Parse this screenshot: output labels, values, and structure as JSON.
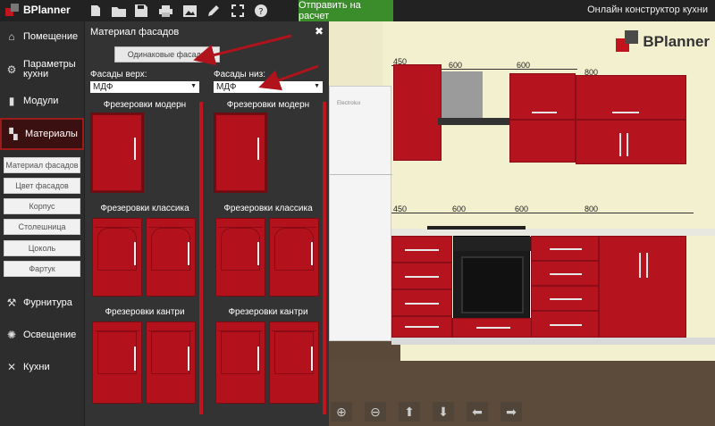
{
  "app": {
    "logo_text": "BPlanner",
    "send_button": "Отправить на расчет",
    "top_right_text": "Онлайн конструктор кухни"
  },
  "toolbar_icons": [
    "new-file-icon",
    "open-folder-icon",
    "save-icon",
    "print-icon",
    "image-icon",
    "pencil-icon",
    "fullscreen-icon",
    "help-icon"
  ],
  "sidebar": {
    "items": [
      {
        "label": "Помещение",
        "icon": "home-icon"
      },
      {
        "label": "Параметры кухни",
        "icon": "gear-icon"
      },
      {
        "label": "Модули",
        "icon": "module-icon"
      },
      {
        "label": "Материалы",
        "icon": "paint-roller-icon"
      },
      {
        "label": "Фурнитура",
        "icon": "hammer-icon"
      },
      {
        "label": "Освещение",
        "icon": "lightbulb-icon"
      },
      {
        "label": "Кухни",
        "icon": "tools-icon"
      }
    ],
    "material_subitems": [
      "Материал фасадов",
      "Цвет фасадов",
      "Корпус",
      "Столешница",
      "Цоколь",
      "Фартук"
    ]
  },
  "panel": {
    "title": "Материал фасадов",
    "same_facades_button": "Одинаковые фасады",
    "upper_label": "Фасады верх:",
    "lower_label": "Фасады низ:",
    "upper_value": "МДФ",
    "lower_value": "МДФ",
    "groups": [
      "Фрезеровки модерн",
      "Фрезеровки классика",
      "Фрезеровки кантри"
    ]
  },
  "view": {
    "brand": "BPlanner",
    "fridge_brand": "Electrolux",
    "dims_upper": [
      "450",
      "600",
      "600",
      "800"
    ],
    "dims_lower": [
      "450",
      "600",
      "600",
      "800"
    ]
  },
  "colors": {
    "accent_red": "#c0141f",
    "green": "#3b8d2c"
  }
}
